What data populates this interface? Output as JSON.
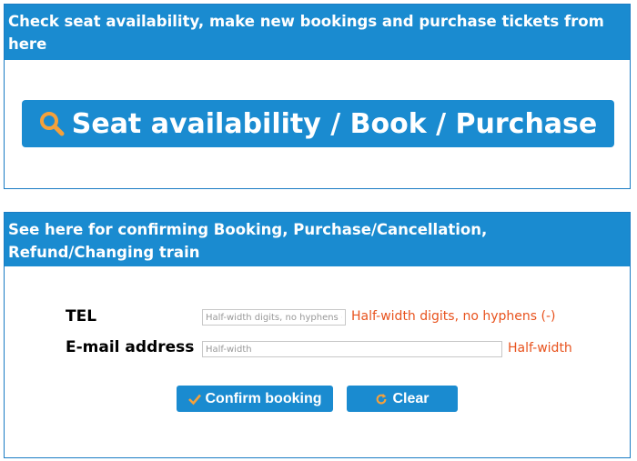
{
  "search_panel": {
    "header": "Check seat availability, make new bookings and purchase tickets from here",
    "button_label": "Seat availability / Book / Purchase",
    "button_icon": "search-icon",
    "icon_color": "#f5a13b"
  },
  "confirm_panel": {
    "header_line1": "See here for confirming Booking, Purchase/Cancellation,",
    "header_line2": "Refund/Changing train",
    "tel": {
      "label": "TEL",
      "placeholder": "Half-width digits, no hyphens (-)",
      "value": "",
      "hint": "Half-width digits, no hyphens (-)"
    },
    "email": {
      "label": "E-mail address",
      "placeholder": "Half-width",
      "value": "",
      "hint": "Half-width"
    },
    "confirm_button": {
      "label": "Confirm booking",
      "icon": "checkmark-icon"
    },
    "clear_button": {
      "label": "Clear",
      "icon": "refresh-icon"
    }
  },
  "colors": {
    "accent": "#1a8bd0",
    "hint": "#e8531e",
    "icon": "#f5a13b"
  }
}
